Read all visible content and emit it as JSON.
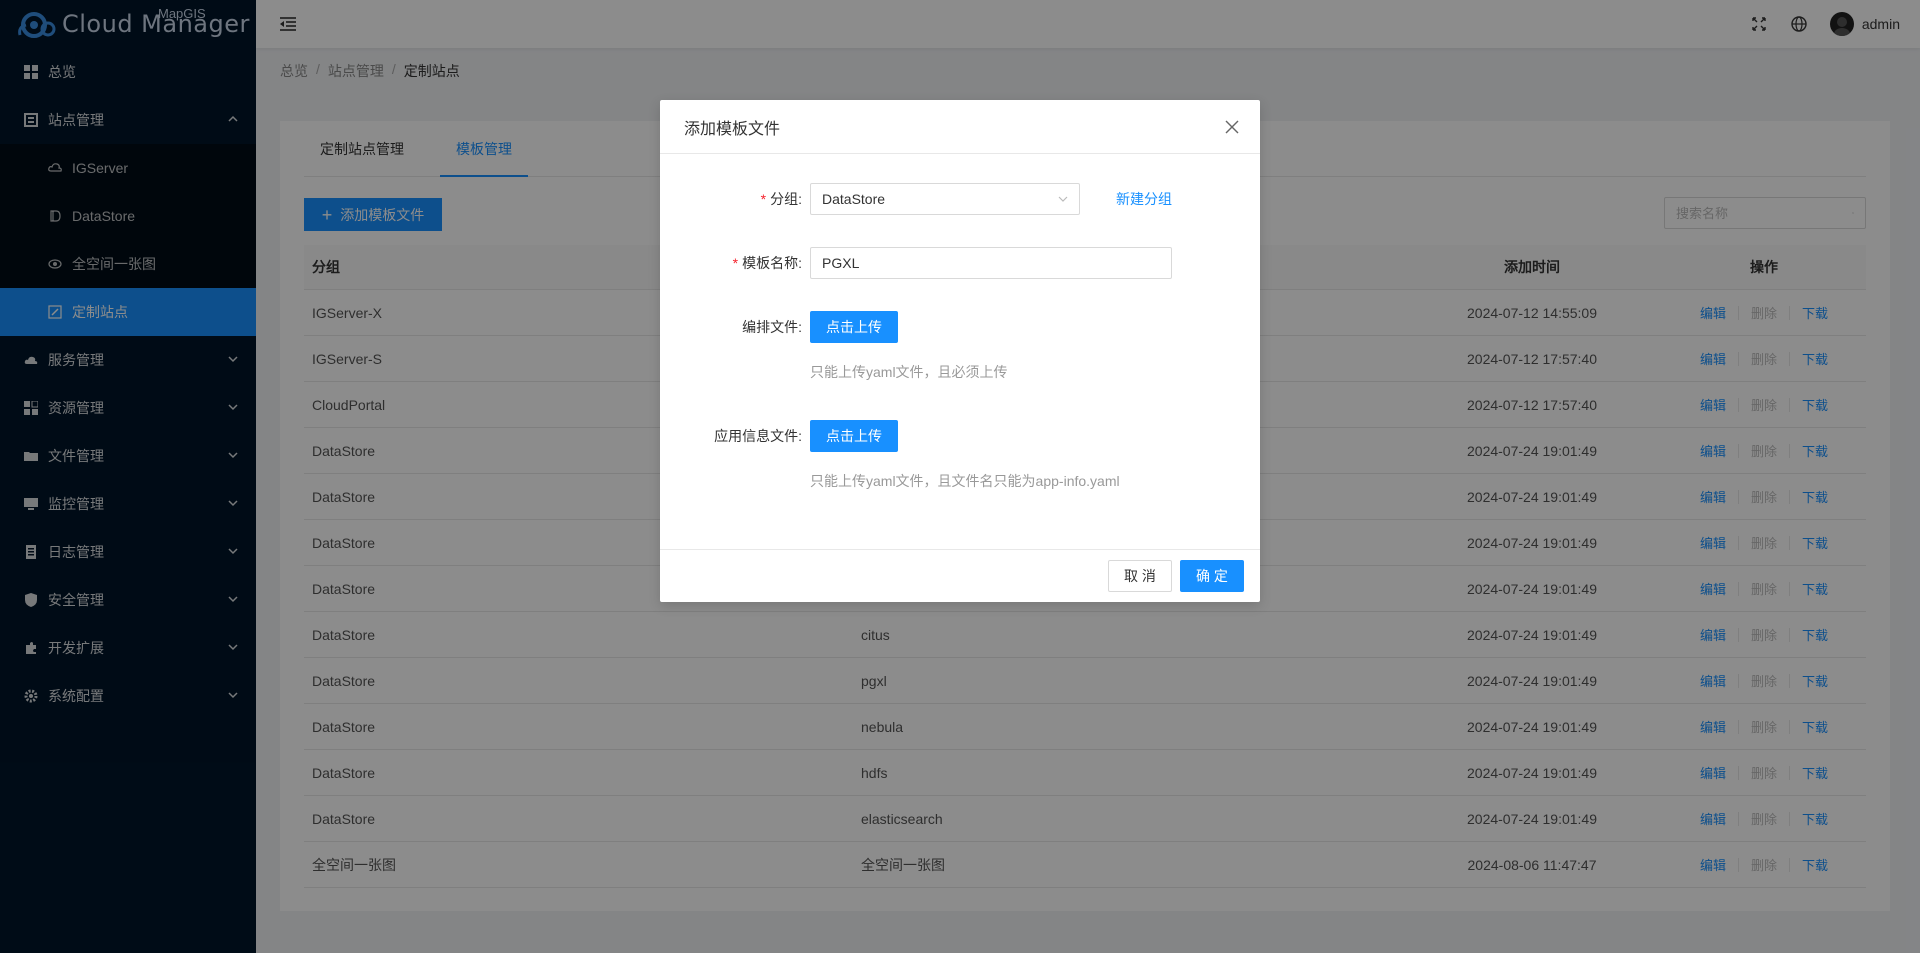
{
  "app": {
    "logo_text": "Cloud Manager",
    "logo_sup": "MapGIS",
    "username": "admin"
  },
  "sidebar": {
    "items": [
      {
        "label": "总览",
        "icon": "dashboard-icon"
      },
      {
        "label": "站点管理",
        "icon": "site-icon",
        "expanded": true
      },
      {
        "label": "服务管理",
        "icon": "cloud-service-icon"
      },
      {
        "label": "资源管理",
        "icon": "resource-icon"
      },
      {
        "label": "文件管理",
        "icon": "folder-icon"
      },
      {
        "label": "监控管理",
        "icon": "monitor-icon"
      },
      {
        "label": "日志管理",
        "icon": "log-icon"
      },
      {
        "label": "安全管理",
        "icon": "shield-icon"
      },
      {
        "label": "开发扩展",
        "icon": "extension-icon"
      },
      {
        "label": "系统配置",
        "icon": "gear-icon"
      }
    ],
    "sub_items": [
      {
        "label": "IGServer",
        "icon": "cloud-icon"
      },
      {
        "label": "DataStore",
        "icon": "datastore-icon"
      },
      {
        "label": "全空间一张图",
        "icon": "map-icon"
      },
      {
        "label": "定制站点",
        "icon": "edit-site-icon",
        "active": true
      }
    ]
  },
  "breadcrumb": {
    "items": [
      "总览",
      "站点管理"
    ],
    "current": "定制站点"
  },
  "tabs": [
    {
      "label": "定制站点管理"
    },
    {
      "label": "模板管理",
      "active": true
    }
  ],
  "toolbar": {
    "add_label": "添加模板文件",
    "search_placeholder": "搜索名称"
  },
  "table": {
    "headers": [
      "分组",
      "",
      "添加时间",
      "操作"
    ],
    "ops": {
      "edit": "编辑",
      "delete": "删除",
      "download": "下载"
    },
    "rows": [
      {
        "group": "IGServer-X",
        "name": "",
        "time": "2024-07-12 14:55:09"
      },
      {
        "group": "IGServer-S",
        "name": "",
        "time": "2024-07-12 17:57:40"
      },
      {
        "group": "CloudPortal",
        "name": "",
        "time": "2024-07-12 17:57:40"
      },
      {
        "group": "DataStore",
        "name": "",
        "time": "2024-07-24 19:01:49"
      },
      {
        "group": "DataStore",
        "name": "",
        "time": "2024-07-24 19:01:49"
      },
      {
        "group": "DataStore",
        "name": "",
        "time": "2024-07-24 19:01:49"
      },
      {
        "group": "DataStore",
        "name": "",
        "time": "2024-07-24 19:01:49"
      },
      {
        "group": "DataStore",
        "name": "citus",
        "time": "2024-07-24 19:01:49"
      },
      {
        "group": "DataStore",
        "name": "pgxl",
        "time": "2024-07-24 19:01:49"
      },
      {
        "group": "DataStore",
        "name": "nebula",
        "time": "2024-07-24 19:01:49"
      },
      {
        "group": "DataStore",
        "name": "hdfs",
        "time": "2024-07-24 19:01:49"
      },
      {
        "group": "DataStore",
        "name": "elasticsearch",
        "time": "2024-07-24 19:01:49"
      },
      {
        "group": "全空间一张图",
        "name": "全空间一张图",
        "time": "2024-08-06 11:47:47"
      }
    ]
  },
  "modal": {
    "title": "添加模板文件",
    "group_label": "分组:",
    "group_value": "DataStore",
    "new_group": "新建分组",
    "name_label": "模板名称:",
    "name_value": "PGXL",
    "compose_label": "编排文件:",
    "upload_label": "点击上传",
    "compose_hint": "只能上传yaml文件，且必须上传",
    "appinfo_label": "应用信息文件:",
    "appinfo_hint": "只能上传yaml文件，且文件名只能为app-info.yaml",
    "cancel": "取 消",
    "ok": "确 定"
  },
  "colors": {
    "primary": "#1890ff",
    "sidebar_bg": "#001529",
    "danger": "#f5222d"
  }
}
